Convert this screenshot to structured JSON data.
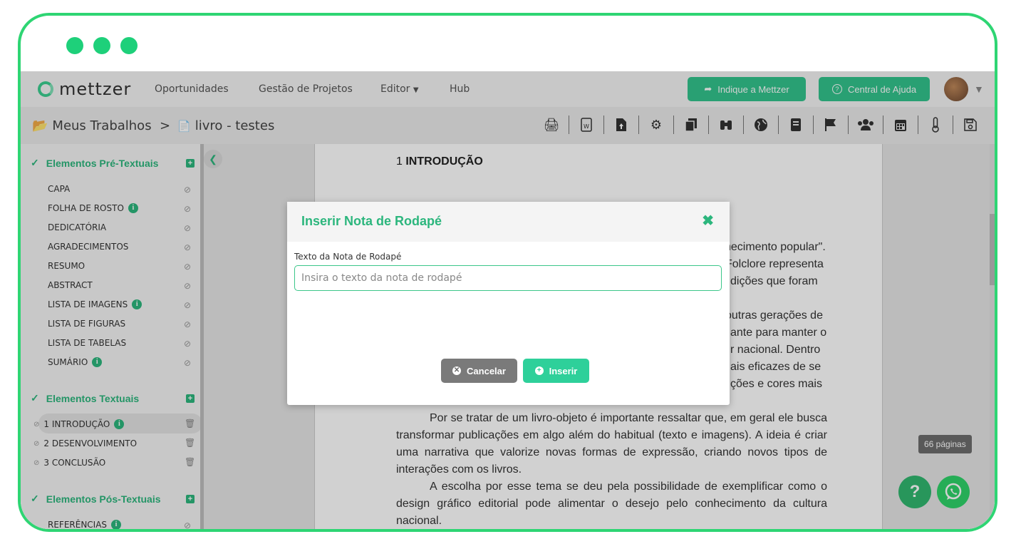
{
  "brand": {
    "name": "mettzer"
  },
  "nav": {
    "menu": [
      "Oportunidades",
      "Gestão de Projetos",
      "Editor",
      "Hub"
    ],
    "indique_label": "Indique a Mettzer",
    "ajuda_label": "Central de Ajuda"
  },
  "breadcrumb": {
    "root": "Meus Trabalhos",
    "sep": ">",
    "current": "livro - testes"
  },
  "toolbar_icons": [
    "print-icon",
    "word-export-icon",
    "file-upload-icon",
    "settings-icon",
    "copy-icon",
    "binoculars-icon",
    "globe-icon",
    "book-icon",
    "flag-icon",
    "users-icon",
    "calendar-icon",
    "thermometer-icon",
    "save-icon"
  ],
  "sidebar": {
    "pre": {
      "title": "Elementos Pré-Textuais",
      "items": [
        "CAPA",
        "FOLHA DE ROSTO",
        "DEDICATÓRIA",
        "AGRADECIMENTOS",
        "RESUMO",
        "ABSTRACT",
        "LISTA DE IMAGENS",
        "LISTA DE FIGURAS",
        "LISTA DE TABELAS",
        "SUMÁRIO"
      ]
    },
    "textual": {
      "title": "Elementos Textuais",
      "items": [
        "1 INTRODUÇÃO",
        "2 DESENVOLVIMENTO",
        "3 CONCLUSÃO"
      ]
    },
    "pos": {
      "title": "Elementos Pós-Textuais",
      "items": [
        "REFERÊNCIAS"
      ]
    }
  },
  "document": {
    "heading_num": "1",
    "heading": "INTRODUÇÃO",
    "fragments": [
      "hecimento popular\".",
      "Folclore representa",
      "dições que foram",
      "outras gerações de",
      "ante para manter o",
      "r nacional. Dentro",
      "ais eficazes de se",
      "ções e cores mais"
    ],
    "para1": "Por se tratar de um livro-objeto é importante ressaltar que, em geral ele busca transformar publicações em algo além do habitual (texto e imagens). A ideia é criar uma narrativa que valorize novas formas de expressão, criando novos tipos de interações com os livros.",
    "para2": "A escolha por esse tema se deu pela possibilidade de exemplificar como o design gráfico editorial pode alimentar o desejo pelo conhecimento da cultura nacional."
  },
  "page_count": "66 páginas",
  "help_fab": "?",
  "modal": {
    "title": "Inserir Nota de Rodapé",
    "close": "✖",
    "label": "Texto da Nota de Rodapé",
    "placeholder": "Insira o texto da nota de rodapé",
    "value": "",
    "cancel_label": "Cancelar",
    "insert_label": "Inserir"
  },
  "colors": {
    "accent": "#2cb67d",
    "frame": "#2ed573"
  }
}
